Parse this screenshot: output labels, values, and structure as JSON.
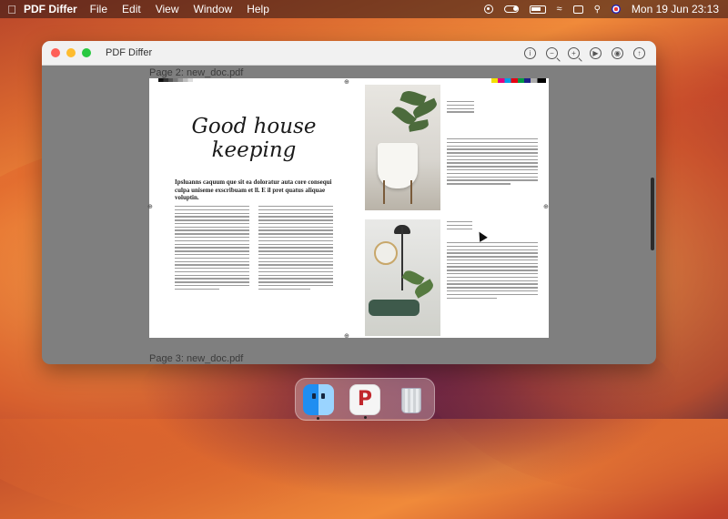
{
  "menubar": {
    "app_name": "PDF Differ",
    "menus": [
      "File",
      "Edit",
      "View",
      "Window",
      "Help"
    ],
    "clock": "Mon 19 Jun  23:13"
  },
  "window": {
    "title": "PDF Differ",
    "toolbar_icons": [
      "info-icon",
      "zoom-out-icon",
      "zoom-in-icon",
      "play-icon",
      "eye-icon",
      "export-icon"
    ]
  },
  "document": {
    "page2_label": "Page 2: new_doc.pdf",
    "page3_label": "Page 3: new_doc.pdf",
    "headline": "Good house keeping",
    "subheading": "Ipsluanns caquum que sit ea doloratur auta core consequi culpa uniseme exscribuam et ll. E il pret quatus aliquae voluptin."
  },
  "dock": {
    "apps": [
      "Finder",
      "PDF Differ",
      "Trash"
    ]
  }
}
